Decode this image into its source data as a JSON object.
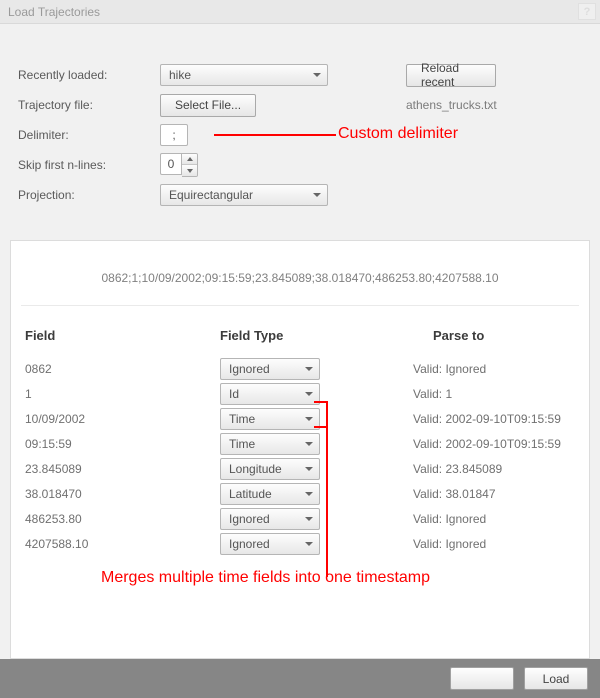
{
  "window": {
    "title": "Load Trajectories"
  },
  "form": {
    "recently_loaded_label": "Recently loaded:",
    "recently_loaded_value": "hike",
    "reload_recent_label": "Reload recent",
    "trajectory_file_label": "Trajectory file:",
    "select_file_label": "Select File...",
    "selected_file_name": "athens_trucks.txt",
    "delimiter_label": "Delimiter:",
    "delimiter_value": ";",
    "skip_lines_label": "Skip first n-lines:",
    "skip_lines_value": "0",
    "projection_label": "Projection:",
    "projection_value": "Equirectangular"
  },
  "annotations": {
    "custom_delimiter": "Custom delimiter",
    "merge_time": "Merges multiple time fields into one timestamp"
  },
  "preview": {
    "sample_line": "0862;1;10/09/2002;09:15:59;23.845089;38.018470;486253.80;4207588.10",
    "headers": {
      "field": "Field",
      "type": "Field Type",
      "parse": "Parse to"
    },
    "rows": [
      {
        "field": "0862",
        "type": "Ignored",
        "parse": "Valid: Ignored"
      },
      {
        "field": "1",
        "type": "Id",
        "parse": "Valid: 1"
      },
      {
        "field": "10/09/2002",
        "type": "Time",
        "parse": "Valid: 2002-09-10T09:15:59"
      },
      {
        "field": "09:15:59",
        "type": "Time",
        "parse": "Valid: 2002-09-10T09:15:59"
      },
      {
        "field": "23.845089",
        "type": "Longitude",
        "parse": "Valid: 23.845089"
      },
      {
        "field": "38.018470",
        "type": "Latitude",
        "parse": "Valid: 38.01847"
      },
      {
        "field": "486253.80",
        "type": "Ignored",
        "parse": "Valid: Ignored"
      },
      {
        "field": "4207588.10",
        "type": "Ignored",
        "parse": "Valid: Ignored"
      }
    ]
  },
  "footer": {
    "blank_button": "",
    "load_button": "Load"
  },
  "colors": {
    "accent": "#ff0000"
  }
}
